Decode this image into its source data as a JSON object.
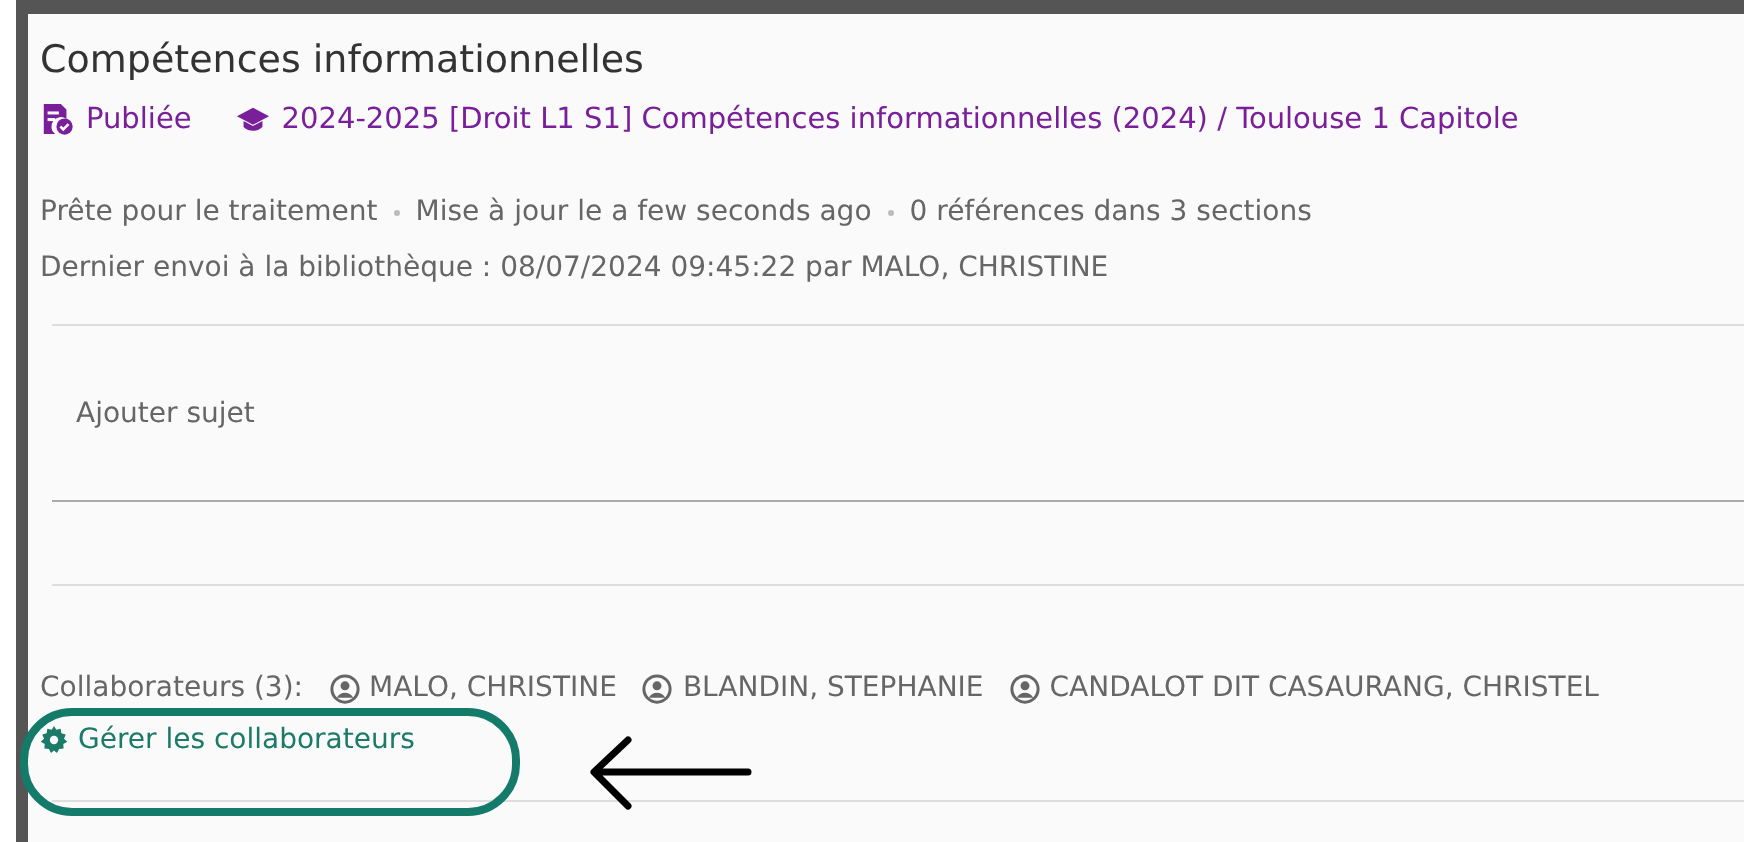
{
  "title": "Compétences informationnelles",
  "status": {
    "label": "Publiée"
  },
  "course": {
    "label": "2024-2025 [Droit L1 S1] Compétences informationnelles (2024) / Toulouse 1 Capitole"
  },
  "meta": [
    "Prête pour le traitement",
    "Mise à jour le a few seconds ago",
    "0 références dans 3 sections"
  ],
  "last_sent": "Dernier envoi à la bibliothèque : 08/07/2024 09:45:22 par MALO, CHRISTINE",
  "subject_field": {
    "placeholder": "Ajouter sujet"
  },
  "collaborators": {
    "label": "Collaborateurs (3):",
    "people": [
      "MALO, CHRISTINE",
      "BLANDIN, STEPHANIE",
      "CANDALOT DIT CASAURANG, CHRISTEL"
    ]
  },
  "manage_link": "Gérer les collaborateurs"
}
